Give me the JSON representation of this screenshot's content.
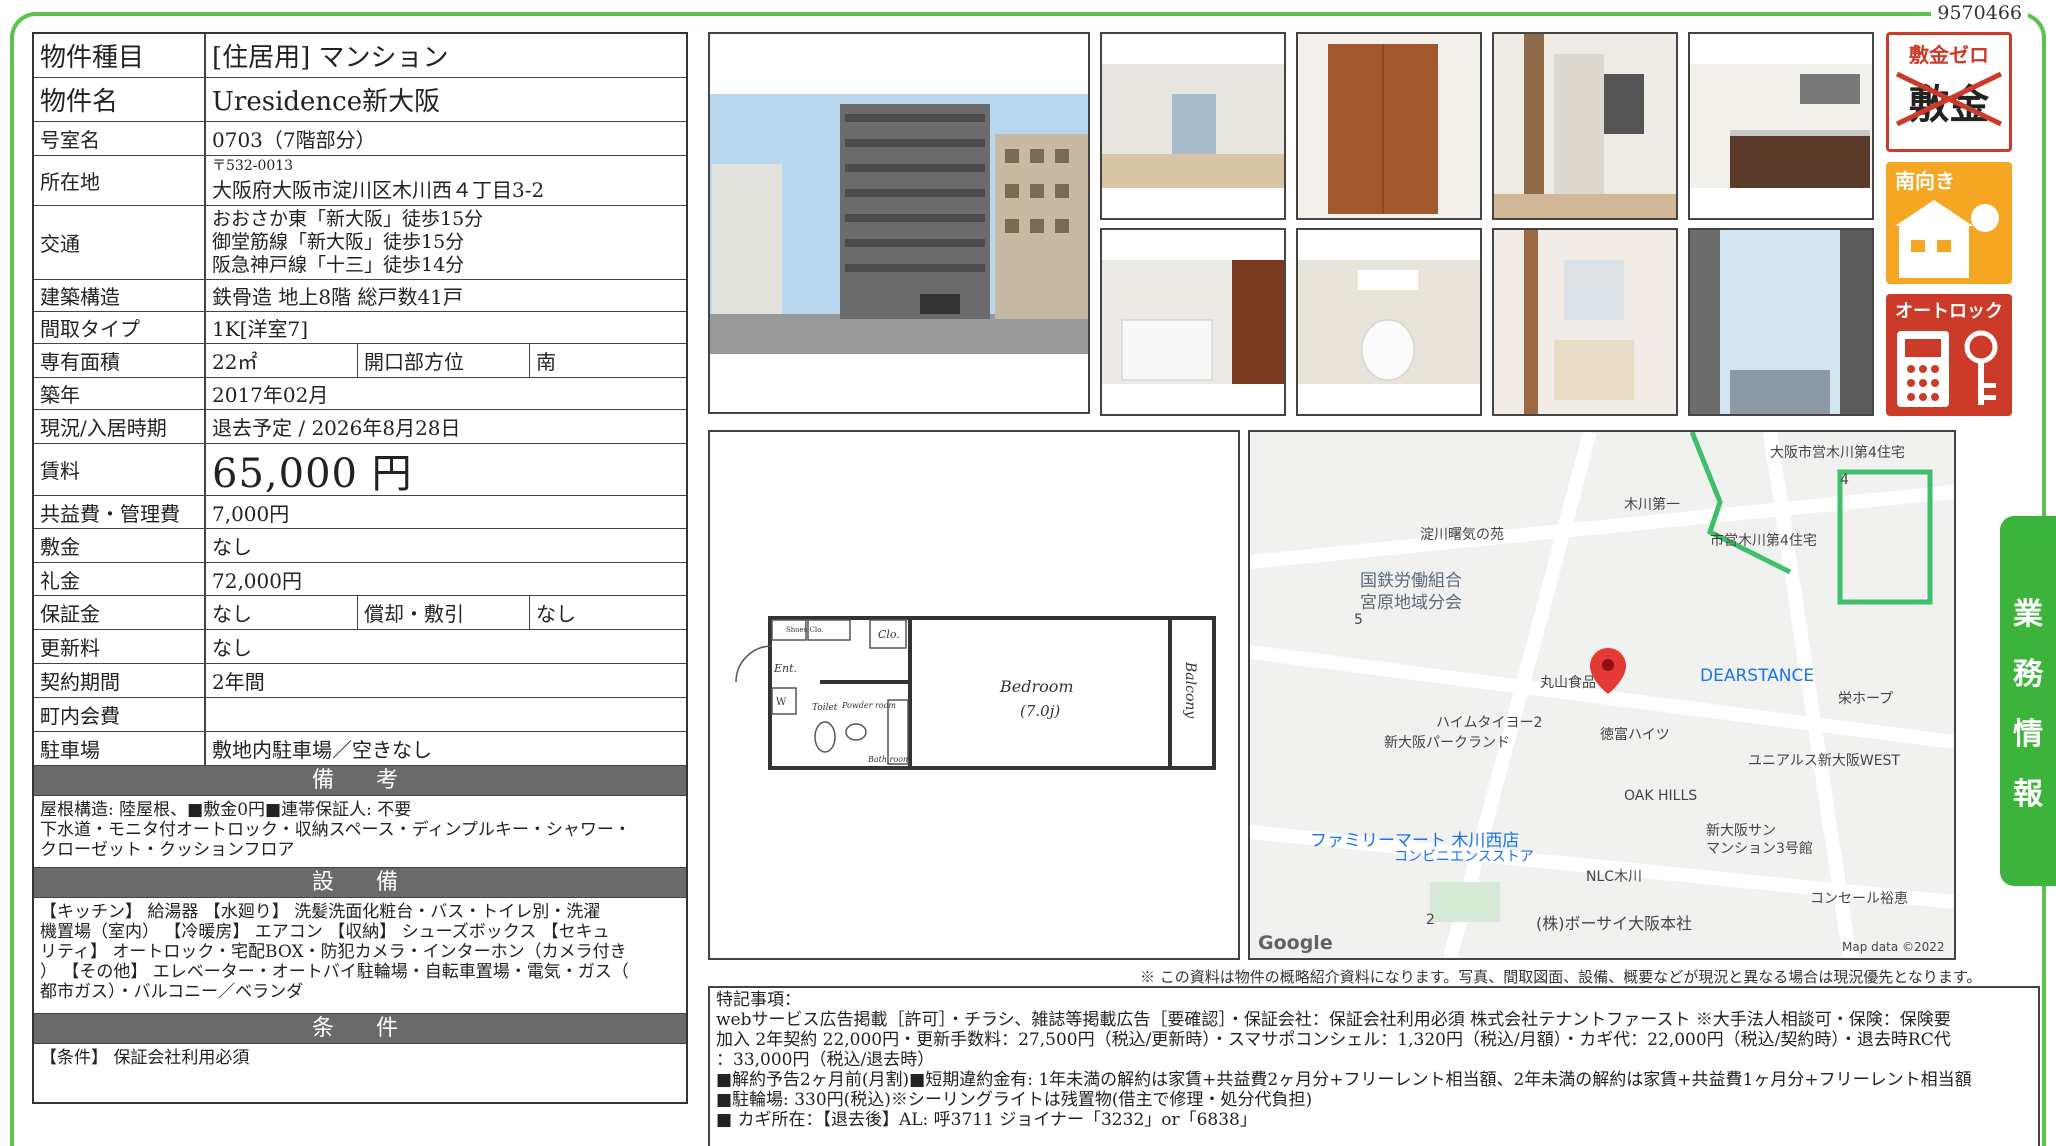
{
  "property_id": "9570466",
  "info": {
    "type_label": "物件種目",
    "type_value": "[住居用] マンション",
    "name_label": "物件名",
    "name_value": "Uresidence新大阪",
    "room_label": "号室名",
    "room_value": "0703（7階部分）",
    "address_label": "所在地",
    "postal": "〒532-0013",
    "address": "大阪府大阪市淀川区木川西４丁目3-2",
    "transport_label": "交通",
    "transport_lines": [
      "おおさか東「新大阪」徒歩15分",
      "御堂筋線「新大阪」徒歩15分",
      "阪急神戸線「十三」徒歩14分"
    ],
    "structure_label": "建築構造",
    "structure_value": "鉄骨造 地上8階 総戸数41戸",
    "layout_label": "間取タイプ",
    "layout_value": "1K[洋室7]",
    "area_label": "専有面積",
    "area_value": "22㎡",
    "direction_label": "開口部方位",
    "direction_value": "南",
    "built_label": "築年",
    "built_value": "2017年02月",
    "status_label": "現況/入居時期",
    "status_value": "退去予定 / 2026年8月28日",
    "rent_label": "賃料",
    "rent_value": "65,000 円",
    "fee_label": "共益費・管理費",
    "fee_value": "7,000円",
    "deposit_label": "敷金",
    "deposit_value": "なし",
    "key_money_label": "礼金",
    "key_money_value": "72,000円",
    "guarantee_label": "保証金",
    "guarantee_value": "なし",
    "amortization_label": "償却・敷引",
    "amortization_value": "なし",
    "renewal_label": "更新料",
    "renewal_value": "なし",
    "contract_label": "契約期間",
    "contract_value": "2年間",
    "association_label": "町内会費",
    "association_value": "",
    "parking_label": "駐車場",
    "parking_value": "敷地内駐車場／空きなし"
  },
  "remarks": {
    "title": "備　考",
    "lines": [
      "屋根構造: 陸屋根、■敷金0円■連帯保証人: 不要",
      "下水道・モニタ付オートロック・収納スペース・ディンプルキー・シャワー・",
      "クローゼット・クッションフロア"
    ]
  },
  "equipment": {
    "title": "設　備",
    "lines": [
      "【キッチン】 給湯器 【水廻り】 洗髪洗面化粧台・バス・トイレ別・洗濯",
      "機置場（室内） 【冷暖房】 エアコン 【収納】 シューズボックス 【セキュ",
      "リティ】 オートロック・宅配BOX・防犯カメラ・インターホン（カメラ付き",
      "） 【その他】 エレベーター・オートバイ駐輪場・自転車置場・電気・ガス（",
      "都市ガス）・バルコニー／ベランダ"
    ]
  },
  "conditions": {
    "title": "条　件",
    "lines": [
      "【条件】 保証会社利用必須"
    ]
  },
  "badges": {
    "zero_deposit": "敷金ゼロ",
    "crossed_word": "敷金",
    "south": "南向き",
    "autolock": "オートロック"
  },
  "floorplan": {
    "bedroom": "Bedroom",
    "bedroom_size": "(7.0j)",
    "balcony": "Balcony",
    "entrance": "Ent.",
    "toilet": "Toilet",
    "powder": "Powder room",
    "bath": "Bath room",
    "closet": "Clo.",
    "shoes": "Shoes Clo.",
    "washer": "W"
  },
  "map": {
    "labels": [
      "大阪市営木川第4住宅",
      "木川第一",
      "淀川曙気の苑",
      "市営木川第4住宅",
      "国鉄労働組合",
      "宮原地域分会",
      "丸山食品",
      "DEARSTANCE",
      "ハイムタイヨー2",
      "徳富ハイツ",
      "栄ホープ",
      "新大阪パークランド",
      "ユニアルス新大阪WEST",
      "OAK HILLS",
      "新大阪サン",
      "マンション3号館",
      "ファミリーマート 木川西店",
      "コンビニエンスストア",
      "NLC木川",
      "コンセール裕恵",
      "(株)ボーサイ大阪本社"
    ],
    "numbers": [
      "4",
      "5",
      "2"
    ],
    "logo": "Google",
    "copyright": "Map data ©2022"
  },
  "disclaimer": "※ この資料は物件の概略紹介資料になります。写真、間取図面、設備、概要などが現況と異なる場合は現況優先となります。",
  "notes": {
    "lines": [
      "特記事項：",
      "webサービス広告掲載［許可］・チラシ、雑誌等掲載広告［要確認］・保証会社：保証会社利用必須 株式会社テナントファースト ※大手法人相談可・保険：保険要",
      "加入 2年契約 22,000円・更新手数料：27,500円（税込/更新時）・スマサポコンシェル：1,320円（税込/月額）・カギ代：22,000円（税込/契約時）・退去時RC代",
      "：33,000円（税込/退去時）",
      "■解約予告2ヶ月前(月割)■短期違約金有: 1年未満の解約は家賃+共益費2ヶ月分+フリーレント相当額、2年未満の解約は家賃+共益費1ヶ月分+フリーレント相当額",
      "■駐輪場: 330円(税込)※シーリングライトは残置物(借主で修理・処分代負担)",
      "■ カギ所在：【退去後】AL: 呼3711 ジョイナー「3232」or「6838」"
    ]
  },
  "side_tab": [
    "業",
    "務",
    "情",
    "報"
  ],
  "colors": {
    "accent_green": "#3cb43c",
    "badge_red": "#cc3a2a",
    "badge_orange": "#f5a623",
    "section_gray": "#6a6a6a"
  }
}
